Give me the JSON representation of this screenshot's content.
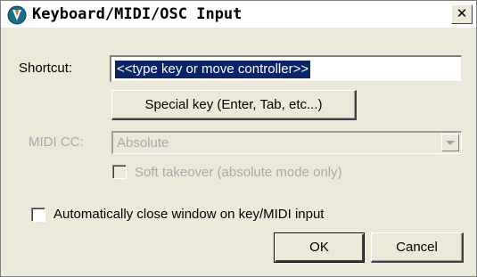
{
  "window": {
    "title": "Keyboard/MIDI/OSC Input",
    "close_glyph": "✕",
    "app_icon": "reaper-logo-icon"
  },
  "shortcut": {
    "label": "Shortcut:",
    "value": "<<type key or move controller>>",
    "selected": true
  },
  "special_key_button": {
    "label": "Special key (Enter, Tab, etc...)"
  },
  "midi_cc": {
    "label": "MIDI CC:",
    "selected": "Absolute",
    "enabled": false
  },
  "soft_takeover": {
    "label": "Soft takeover (absolute mode only)",
    "checked": false,
    "enabled": false
  },
  "auto_close": {
    "label": "Automatically close window on key/MIDI input",
    "checked": false
  },
  "buttons": {
    "ok": "OK",
    "cancel": "Cancel"
  },
  "colors": {
    "dialog_bg": "#ece9d8",
    "selection_bg": "#0a246a",
    "disabled_text": "#a9a9a9"
  }
}
